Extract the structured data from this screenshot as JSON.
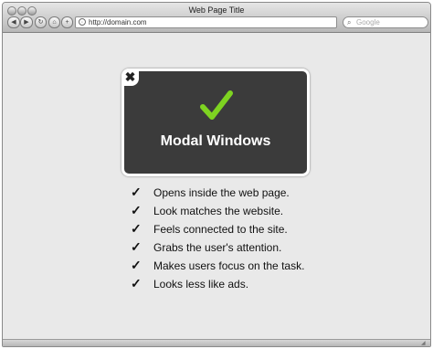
{
  "window": {
    "title": "Web Page Title"
  },
  "toolbar": {
    "back_icon": "back-arrow-icon",
    "forward_icon": "forward-arrow-icon",
    "reload_icon": "reload-icon",
    "home_icon": "home-icon",
    "add_icon": "add-bookmark-icon",
    "url": "http://domain.com",
    "search_placeholder": "Google"
  },
  "modal": {
    "title": "Modal Windows",
    "close_glyph": "✖",
    "check_color": "#7ed321"
  },
  "list": {
    "check_glyph": "✓",
    "items": [
      "Opens inside the web page.",
      "Look matches the website.",
      "Feels connected to the site.",
      "Grabs the user's attention.",
      "Makes users focus on the task.",
      "Looks less like ads."
    ]
  }
}
